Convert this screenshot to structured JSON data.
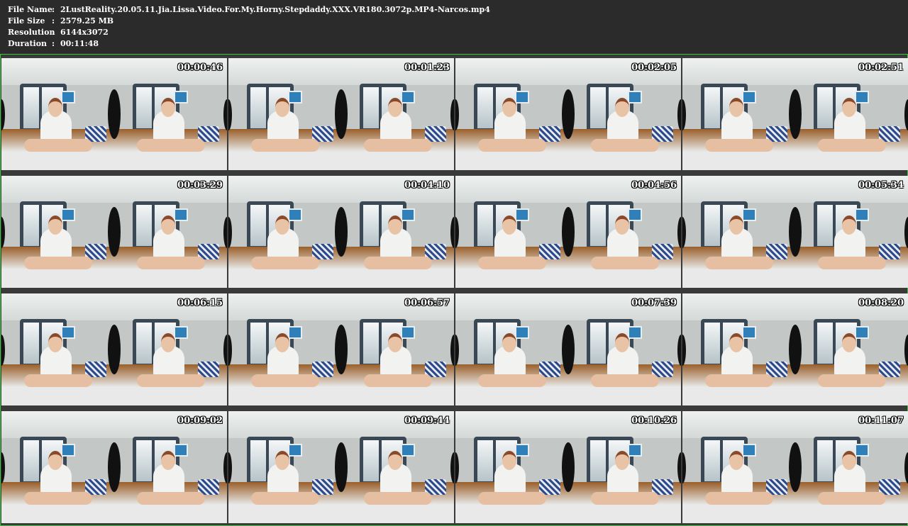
{
  "header": {
    "fields": [
      {
        "label": "File Name",
        "value": "2LustReality.20.05.11.Jia.Lissa.Video.For.My.Horny.Stepdaddy.XXX.VR180.3072p.MP4-Narcos.mp4"
      },
      {
        "label": "File Size",
        "value": "2579.25 MB"
      },
      {
        "label": "Resolution",
        "value": "6144x3072"
      },
      {
        "label": "Duration",
        "value": "00:11:48"
      }
    ],
    "separator": ":"
  },
  "thumbnails": [
    {
      "timestamp": "00:00:46"
    },
    {
      "timestamp": "00:01:23"
    },
    {
      "timestamp": "00:02:05"
    },
    {
      "timestamp": "00:02:51"
    },
    {
      "timestamp": "00:03:29"
    },
    {
      "timestamp": "00:04:10"
    },
    {
      "timestamp": "00:04:56"
    },
    {
      "timestamp": "00:05:34"
    },
    {
      "timestamp": "00:06:15"
    },
    {
      "timestamp": "00:06:57"
    },
    {
      "timestamp": "00:07:39"
    },
    {
      "timestamp": "00:08:20"
    },
    {
      "timestamp": "00:09:02"
    },
    {
      "timestamp": "00:09:44"
    },
    {
      "timestamp": "00:10:26"
    },
    {
      "timestamp": "00:11:07"
    }
  ],
  "colors": {
    "background": "#2b2b2b",
    "frame_border": "#3ec43e",
    "text": "#ffffff"
  }
}
